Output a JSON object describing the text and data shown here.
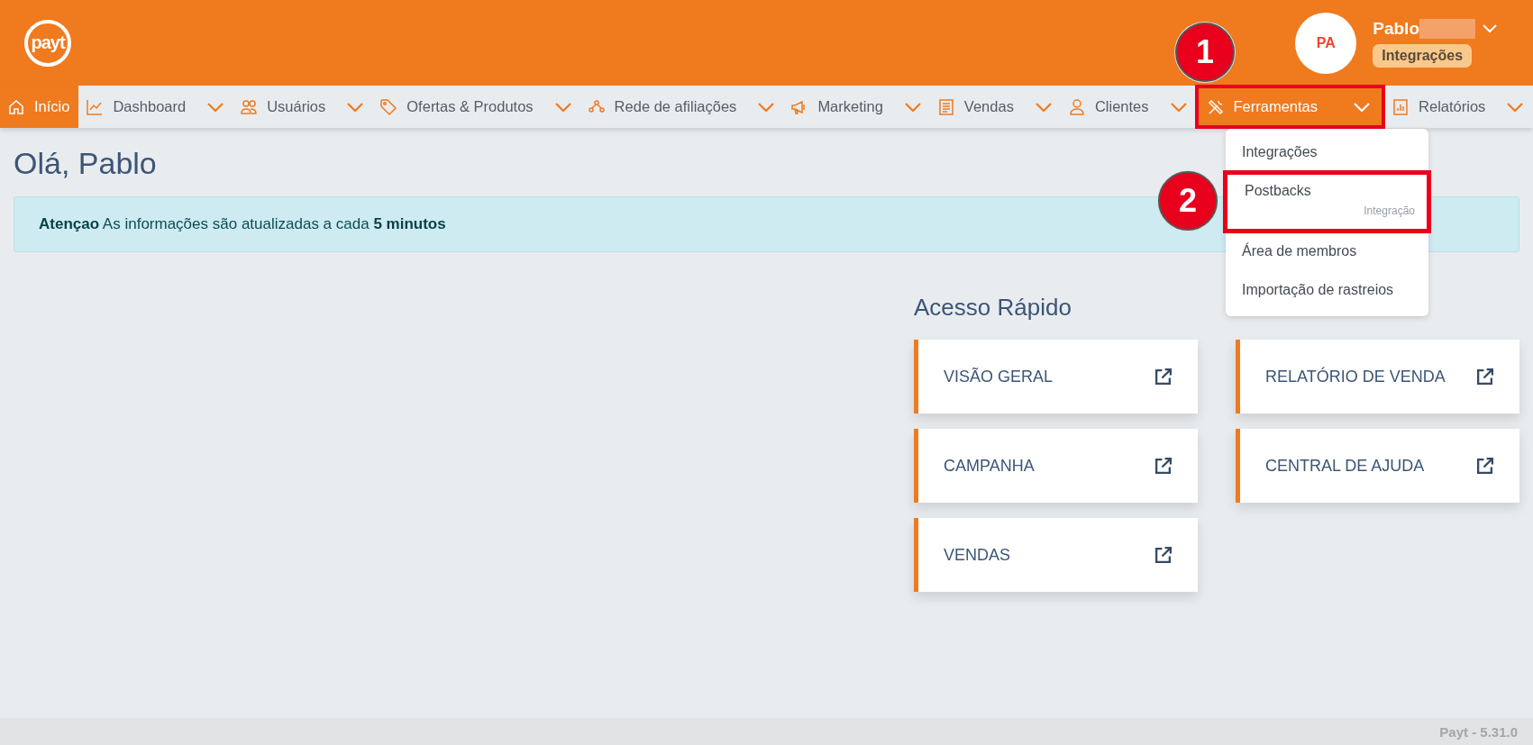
{
  "header": {
    "logo": "payt",
    "user": {
      "initials": "PA",
      "name": "Pablo",
      "badge": "Integrações"
    }
  },
  "nav": [
    {
      "label": "Início",
      "selected": true,
      "has_menu": false,
      "highlighted": false
    },
    {
      "label": "Dashboard",
      "selected": false,
      "has_menu": true,
      "highlighted": false
    },
    {
      "label": "Usuários",
      "selected": false,
      "has_menu": true,
      "highlighted": false
    },
    {
      "label": "Ofertas & Produtos",
      "selected": false,
      "has_menu": true,
      "highlighted": false
    },
    {
      "label": "Rede de afiliações",
      "selected": false,
      "has_menu": true,
      "highlighted": false
    },
    {
      "label": "Marketing",
      "selected": false,
      "has_menu": true,
      "highlighted": false
    },
    {
      "label": "Vendas",
      "selected": false,
      "has_menu": true,
      "highlighted": false
    },
    {
      "label": "Clientes",
      "selected": false,
      "has_menu": true,
      "highlighted": false
    },
    {
      "label": "Ferramentas",
      "selected": true,
      "has_menu": true,
      "highlighted": true
    },
    {
      "label": "Relatórios",
      "selected": false,
      "has_menu": true,
      "highlighted": false
    }
  ],
  "dropdown": [
    {
      "label": "Integrações",
      "highlighted": false
    },
    {
      "label": "Postbacks",
      "note": "Integração",
      "highlighted": true
    },
    {
      "label": "Área de membros",
      "highlighted": false
    },
    {
      "label": "Importação de rastreios",
      "highlighted": false
    }
  ],
  "greeting": "Olá, Pablo",
  "alert": "**Atençao** As informações são atualizadas a cada **5 minutos**",
  "quick_access": {
    "title": "Acesso Rápido",
    "cards": [
      {
        "label": "VISÃO GERAL"
      },
      {
        "label": "RELATÓRIO DE VENDA"
      },
      {
        "label": "CAMPANHA"
      },
      {
        "label": "CENTRAL DE AJUDA"
      },
      {
        "label": "VENDAS"
      }
    ]
  },
  "annotations": [
    {
      "number": "1"
    },
    {
      "number": "2"
    }
  ],
  "footer": "Payt - 5.31.0"
}
